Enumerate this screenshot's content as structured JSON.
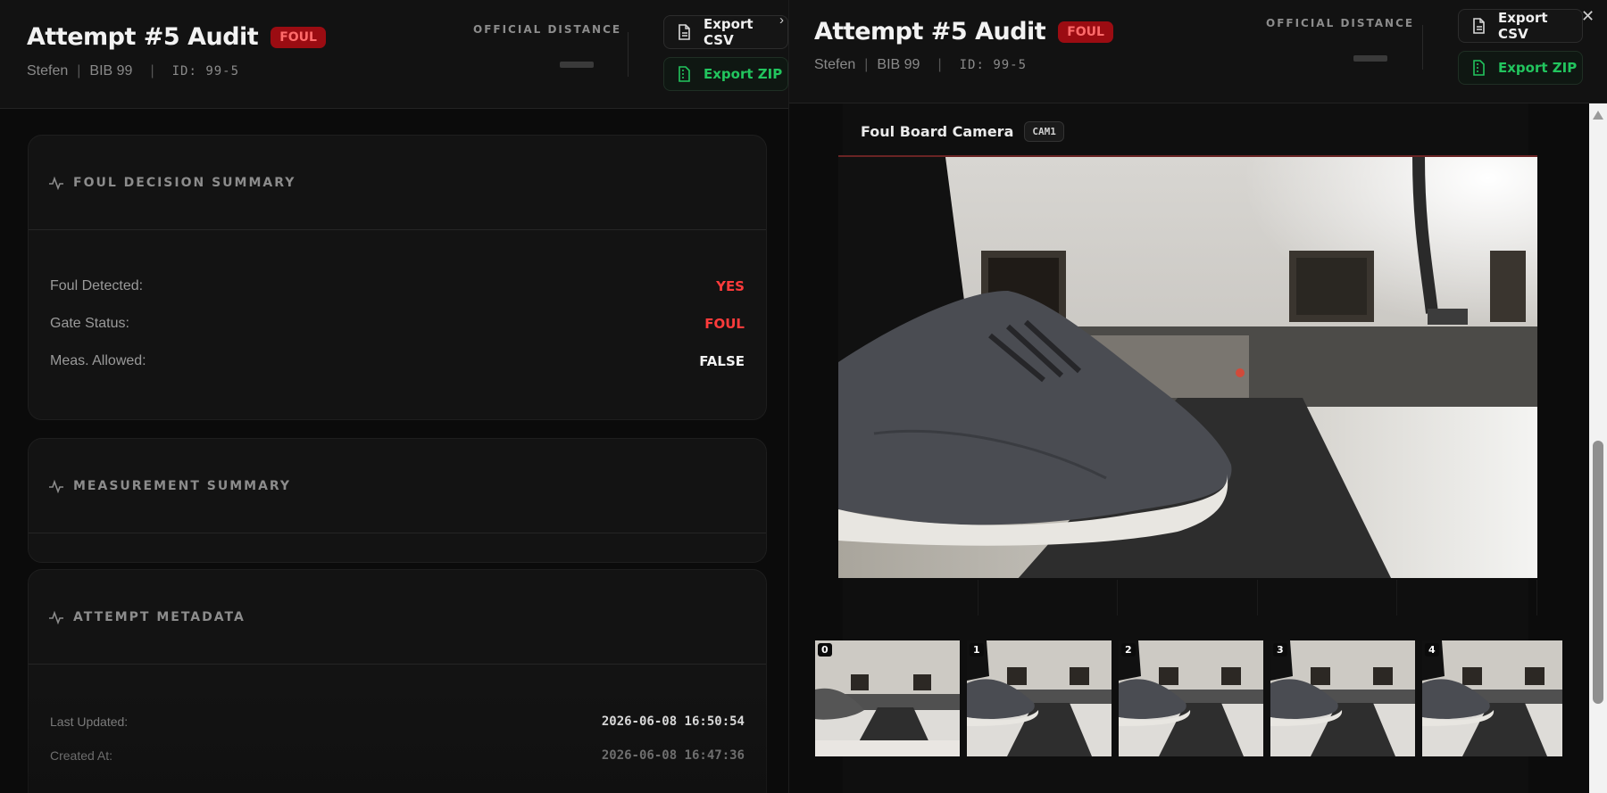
{
  "attempt": {
    "title": "Attempt #5 Audit",
    "status_badge": "FOUL",
    "athlete": "Stefen",
    "bib": "BIB 99",
    "id_label": "ID: 99-5",
    "separator": "|"
  },
  "official_distance": {
    "label": "OFFICIAL DISTANCE"
  },
  "buttons": {
    "export_csv": "Export CSV",
    "export_zip": "Export ZIP"
  },
  "icons": {
    "close": "close-icon",
    "chevron": "chevron-right-icon",
    "csv": "file-icon",
    "zip": "file-zip-icon",
    "activity": "activity-icon"
  },
  "foul_summary": {
    "title": "FOUL DECISION SUMMARY",
    "rows": [
      {
        "label": "Foul Detected:",
        "value": "YES"
      },
      {
        "label": "Gate Status:",
        "value": "FOUL"
      },
      {
        "label": "Meas. Allowed:",
        "value": "FALSE"
      }
    ]
  },
  "measurement_summary": {
    "title": "MEASUREMENT SUMMARY"
  },
  "metadata": {
    "title": "ATTEMPT METADATA",
    "rows": [
      {
        "label": "Last Updated:",
        "value": "2026-06-08 16:50:54"
      },
      {
        "label": "Created At:",
        "value": "2026-06-08 16:47:36"
      }
    ]
  },
  "camera": {
    "title": "Foul Board Camera",
    "badge": "CAM1",
    "frames": [
      "0",
      "1",
      "2",
      "3",
      "4"
    ]
  },
  "colors": {
    "foul_red": "#ff3b3b",
    "badge_bg": "#9b0c12",
    "zip_green": "#22c55e"
  }
}
